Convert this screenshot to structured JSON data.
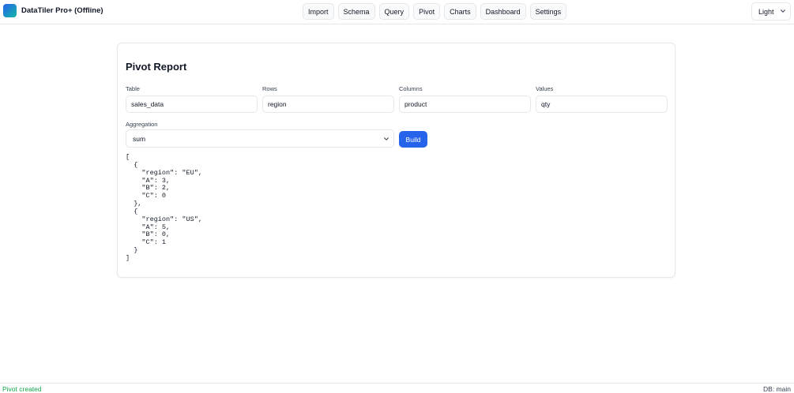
{
  "app": {
    "title": "DataTiler Pro+ (Offline)"
  },
  "nav": {
    "items": [
      "Import",
      "Schema",
      "Query",
      "Pivot",
      "Charts",
      "Dashboard",
      "Settings"
    ]
  },
  "theme": {
    "selected": "Light"
  },
  "pivot": {
    "title": "Pivot Report",
    "fields": [
      {
        "label": "Table",
        "value": "sales_data"
      },
      {
        "label": "Rows",
        "value": "region"
      },
      {
        "label": "Columns",
        "value": "product"
      },
      {
        "label": "Values",
        "value": "qty"
      }
    ],
    "aggregation": {
      "label": "Aggregation",
      "selected": "sum"
    },
    "build_label": "Build",
    "result": "[\n  {\n    \"region\": \"EU\",\n    \"A\": 3,\n    \"B\": 2,\n    \"C\": 0\n  },\n  {\n    \"region\": \"US\",\n    \"A\": 5,\n    \"B\": 0,\n    \"C\": 1\n  }\n]"
  },
  "status": {
    "message": "Pivot created",
    "db": "DB: main"
  },
  "colors": {
    "accent": "#2563eb",
    "success": "#16a34a",
    "border": "#e5e7eb"
  }
}
